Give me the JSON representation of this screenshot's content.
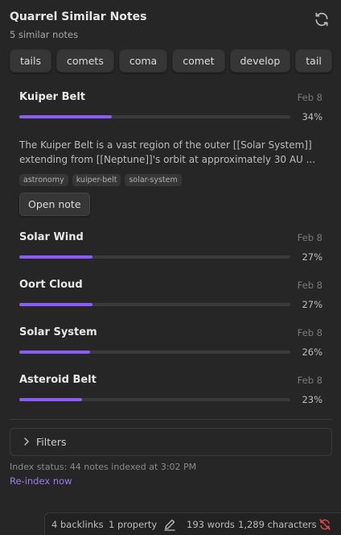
{
  "header": {
    "title": "Quarrel Similar Notes",
    "subtitle": "5 similar notes",
    "refresh_icon": "refresh-icon"
  },
  "tags": [
    "tails",
    "comets",
    "coma",
    "comet",
    "develop",
    "tail"
  ],
  "notes": [
    {
      "title": "Kuiper Belt",
      "date": "Feb 8",
      "percent_label": "34%",
      "percent": 34,
      "excerpt": "The Kuiper Belt is a vast region of the outer [[Solar System]] extending from [[Neptune]]'s orbit at approximately 30 AU ...",
      "tags": [
        "astronomy",
        "kuiper-belt",
        "solar-system"
      ],
      "open_label": "Open note",
      "expanded": true
    },
    {
      "title": "Solar Wind",
      "date": "Feb 8",
      "percent_label": "27%",
      "percent": 27
    },
    {
      "title": "Oort Cloud",
      "date": "Feb 8",
      "percent_label": "27%",
      "percent": 27
    },
    {
      "title": "Solar System",
      "date": "Feb 8",
      "percent_label": "26%",
      "percent": 26
    },
    {
      "title": "Asteroid Belt",
      "date": "Feb 8",
      "percent_label": "23%",
      "percent": 23
    }
  ],
  "filters": {
    "label": "Filters",
    "expanded": false
  },
  "index": {
    "status": "Index status: 44 notes indexed at 3:02 PM",
    "reindex_label": "Re-index now"
  },
  "statusbar": {
    "backlinks": "4 backlinks",
    "properties": "1 property",
    "words": "193 words",
    "characters": "1,289 characters",
    "edit_icon": "pencil-icon",
    "sync_icon": "sync-off-icon"
  },
  "colors": {
    "background": "#262626",
    "accent": "#8a5cf5",
    "link": "#9d7cf0",
    "sync_error": "#e04848"
  }
}
